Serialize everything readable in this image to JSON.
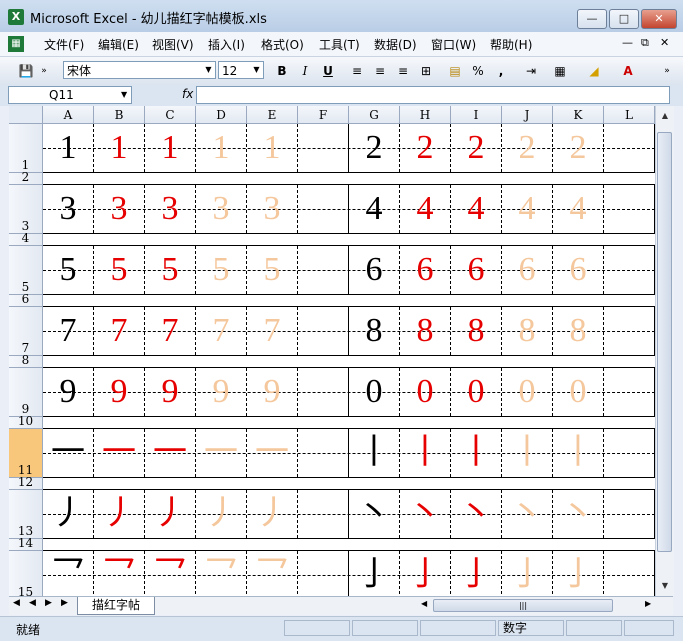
{
  "window": {
    "title": "Microsoft Excel - 幼儿描红字帖模板.xls"
  },
  "menu": [
    "文件(F)",
    "编辑(E)",
    "视图(V)",
    "插入(I)",
    "格式(O)",
    "工具(T)",
    "数据(D)",
    "窗口(W)",
    "帮助(H)"
  ],
  "toolbar": {
    "font_name": "宋体",
    "font_size": "12",
    "bold": "B",
    "italic": "I",
    "underline": "U",
    "percent": "%",
    "comma": ","
  },
  "formula_bar": {
    "name_box": "Q11",
    "fx": "fx",
    "value": ""
  },
  "columns": [
    "A",
    "B",
    "C",
    "D",
    "E",
    "F",
    "G",
    "H",
    "I",
    "J",
    "K",
    "L"
  ],
  "rows": [
    {
      "num": "1",
      "cells": [
        "1",
        "1",
        "1",
        "1",
        "1",
        "",
        "2",
        "2",
        "2",
        "2",
        "2",
        ""
      ]
    },
    {
      "num": "2"
    },
    {
      "num": "3",
      "cells": [
        "3",
        "3",
        "3",
        "3",
        "3",
        "",
        "4",
        "4",
        "4",
        "4",
        "4",
        ""
      ]
    },
    {
      "num": "4"
    },
    {
      "num": "5",
      "cells": [
        "5",
        "5",
        "5",
        "5",
        "5",
        "",
        "6",
        "6",
        "6",
        "6",
        "6",
        ""
      ]
    },
    {
      "num": "6"
    },
    {
      "num": "7",
      "cells": [
        "7",
        "7",
        "7",
        "7",
        "7",
        "",
        "8",
        "8",
        "8",
        "8",
        "8",
        ""
      ]
    },
    {
      "num": "8"
    },
    {
      "num": "9",
      "cells": [
        "9",
        "9",
        "9",
        "9",
        "9",
        "",
        "0",
        "0",
        "0",
        "0",
        "0",
        ""
      ]
    },
    {
      "num": "10"
    },
    {
      "num": "11",
      "cells": [
        "一",
        "一",
        "一",
        "一",
        "一",
        "",
        "丨",
        "丨",
        "丨",
        "丨",
        "丨",
        ""
      ]
    },
    {
      "num": "12"
    },
    {
      "num": "13",
      "cells": [
        "丿",
        "丿",
        "丿",
        "丿",
        "丿",
        "",
        "丶",
        "丶",
        "丶",
        "丶",
        "丶",
        ""
      ]
    },
    {
      "num": "14"
    },
    {
      "num": "15",
      "cells": [
        "乛",
        "乛",
        "乛",
        "乛",
        "乛",
        "",
        "亅",
        "亅",
        "亅",
        "亅",
        "亅",
        ""
      ]
    }
  ],
  "cell_colors": [
    "#000000",
    "#e60000",
    "#e60000",
    "#f5c79c",
    "#f5c79c",
    "#000000",
    "#000000",
    "#e60000",
    "#e60000",
    "#f5c79c",
    "#f5c79c",
    "#000000"
  ],
  "selected_row": "11",
  "sheet_tab": "描红字帖",
  "status": {
    "ready": "就绪",
    "mode": "数字"
  }
}
